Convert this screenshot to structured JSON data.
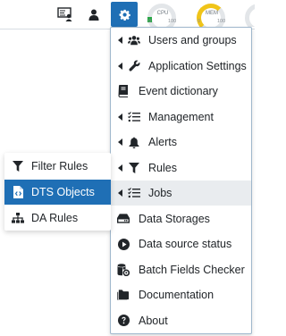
{
  "colors": {
    "accent": "#1f6fb5",
    "cpu_gauge": "#28a745",
    "mem_gauge": "#f0c419",
    "hover_bg": "#e9ecef"
  },
  "topbar": {
    "monitor_icon": "monitor-user-icon",
    "user_icon": "user-icon",
    "settings_icon": "gear-icon",
    "gauges": [
      {
        "label": "CPU",
        "min": "0",
        "max": "100"
      },
      {
        "label": "MEM",
        "min": "0",
        "max": "100"
      }
    ]
  },
  "menu": {
    "items": [
      {
        "label": "Users and groups",
        "icon": "users-icon",
        "has_submenu": true
      },
      {
        "label": "Application Settings",
        "icon": "wrench-icon",
        "has_submenu": true
      },
      {
        "label": "Event dictionary",
        "icon": "book-icon",
        "has_submenu": false
      },
      {
        "label": "Management",
        "icon": "list-check-icon",
        "has_submenu": true
      },
      {
        "label": "Alerts",
        "icon": "bell-icon",
        "has_submenu": true
      },
      {
        "label": "Rules",
        "icon": "filter-icon",
        "has_submenu": true
      },
      {
        "label": "Jobs",
        "icon": "list-check-icon",
        "has_submenu": true
      },
      {
        "label": "Data Storages",
        "icon": "hdd-icon",
        "has_submenu": false
      },
      {
        "label": "Data source status",
        "icon": "play-circle-icon",
        "has_submenu": false
      },
      {
        "label": "Batch Fields Checker",
        "icon": "db-gear-icon",
        "has_submenu": false
      },
      {
        "label": "Documentation",
        "icon": "folder-icon",
        "has_submenu": false
      },
      {
        "label": "About",
        "icon": "question-circle-icon",
        "has_submenu": false
      }
    ]
  },
  "submenu": {
    "items": [
      {
        "label": "Filter Rules",
        "icon": "filter-icon"
      },
      {
        "label": "DTS Objects",
        "icon": "file-code-icon"
      },
      {
        "label": "DA Rules",
        "icon": "sitemap-icon"
      }
    ]
  }
}
